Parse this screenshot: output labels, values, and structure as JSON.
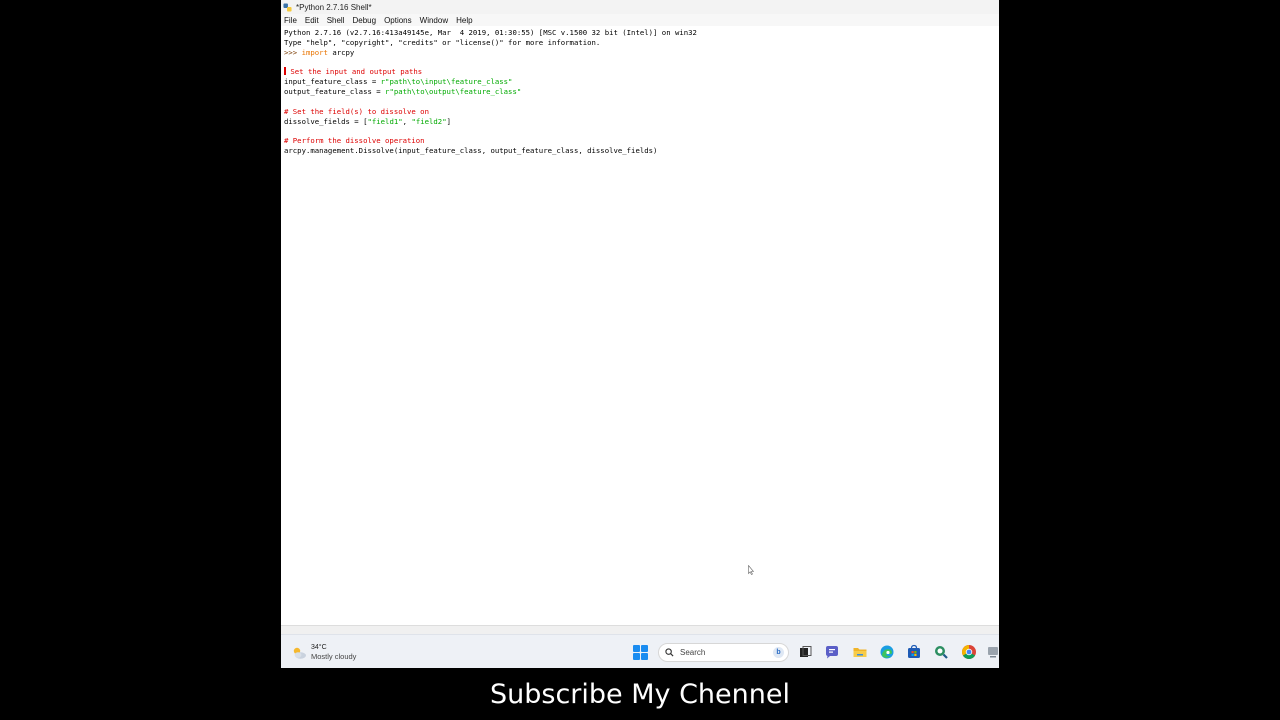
{
  "window": {
    "title": "*Python 2.7.16 Shell*"
  },
  "menu": {
    "items": [
      "File",
      "Edit",
      "Shell",
      "Debug",
      "Options",
      "Window",
      "Help"
    ]
  },
  "shell": {
    "banner_line1": "Python 2.7.16 (v2.7.16:413a49145e, Mar  4 2019, 01:30:55) [MSC v.1500 32 bit (Intel)] on win32",
    "banner_line2": "Type \"help\", \"copyright\", \"credits\" or \"license()\" for more information.",
    "prompt": ">>> ",
    "import_kw": "import",
    "import_module": " arcpy",
    "comment1": " Set the input and output paths",
    "input_var": "input_feature_class = ",
    "input_str": "r\"path\\to\\input\\feature_class\"",
    "output_var": "output_feature_class = ",
    "output_str": "r\"path\\to\\output\\feature_class\"",
    "comment2": "# Set the field(s) to dissolve on",
    "dissolve_var": "dissolve_fields = [",
    "dissolve_str1": "\"field1\"",
    "dissolve_sep": ", ",
    "dissolve_str2": "\"field2\"",
    "dissolve_end": "]",
    "comment3": "# Perform the dissolve operation",
    "call_line": "arcpy.management.Dissolve(input_feature_class, output_feature_class, dissolve_fields)"
  },
  "taskbar": {
    "weather_temp": "34°C",
    "weather_desc": "Mostly cloudy",
    "search_placeholder": "Search",
    "search_badge": "b",
    "icons": [
      "task-view-icon",
      "teams-chat-icon",
      "file-explorer-icon",
      "edge-icon",
      "store-icon",
      "search-app-icon",
      "chrome-icon",
      "network-icon"
    ]
  },
  "caption": {
    "text": "Subscribe My Chennel"
  },
  "colors": {
    "keyword": "#e87400",
    "comment": "#dd0000",
    "string": "#00aa00",
    "start_blue": "#1a8cf0"
  }
}
